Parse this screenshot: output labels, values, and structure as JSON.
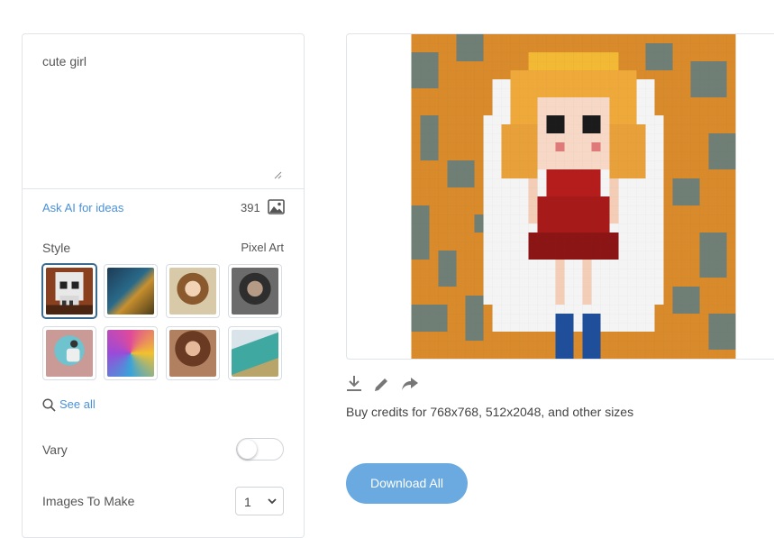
{
  "prompt": {
    "value": "cute girl"
  },
  "ask_ai": {
    "label": "Ask AI for ideas"
  },
  "credits": {
    "count": "391",
    "icon": "image-icon"
  },
  "style": {
    "label": "Style",
    "selected": "Pixel Art",
    "thumbnails": [
      {
        "name": "pixel-art-skull",
        "selected": true
      },
      {
        "name": "lion-warrior",
        "selected": false
      },
      {
        "name": "anime-girl-glasses",
        "selected": false
      },
      {
        "name": "bearded-man-portrait",
        "selected": false
      },
      {
        "name": "flat-illustration-person",
        "selected": false
      },
      {
        "name": "pop-art-portrait",
        "selected": false
      },
      {
        "name": "fantasy-woman",
        "selected": false
      },
      {
        "name": "crocodile-3d",
        "selected": false
      }
    ]
  },
  "see_all": {
    "label": "See all",
    "icon": "search-icon"
  },
  "vary": {
    "label": "Vary",
    "on": false
  },
  "images_to_make": {
    "label": "Images To Make",
    "value": "1"
  },
  "actions": {
    "icons": [
      "download-icon",
      "edit-icon",
      "share-icon"
    ]
  },
  "buy_credits": {
    "text": "Buy credits for 768x768, 512x2048, and other sizes"
  },
  "download_all": {
    "label": "Download All"
  },
  "colors": {
    "accent": "#6aaae0",
    "link": "#4a90d9",
    "selected_border": "#3b6c8f"
  }
}
